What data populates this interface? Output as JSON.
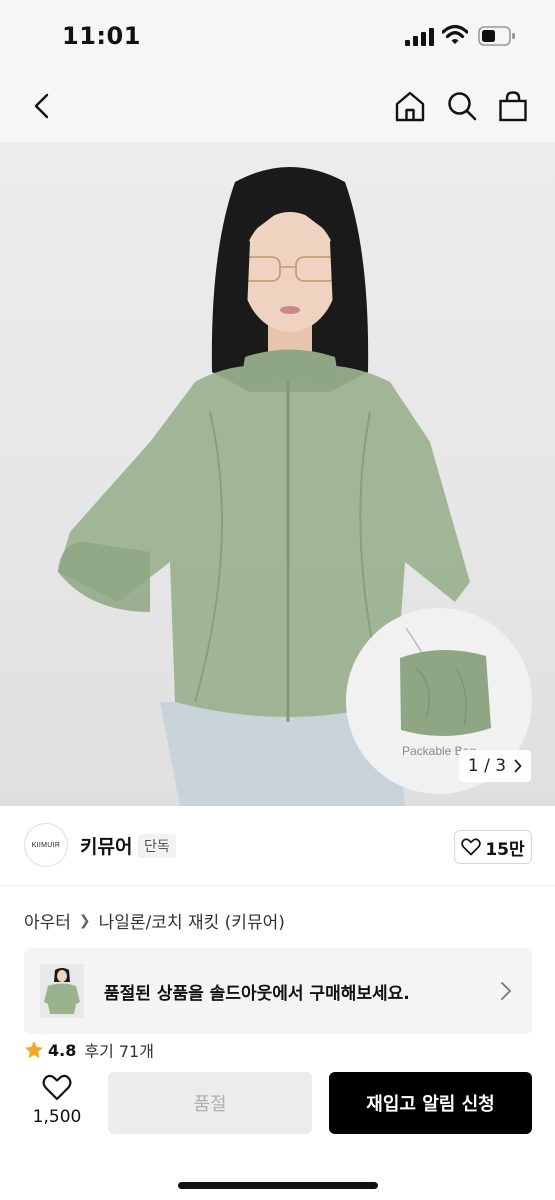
{
  "status_bar": {
    "time": "11:01"
  },
  "nav": {
    "icons": [
      "back-chevron-icon",
      "home-icon",
      "search-icon",
      "shopping-bag-icon"
    ]
  },
  "product_image": {
    "packable_label": "Packable Bag",
    "counter_current": "1",
    "counter_separator": "/",
    "counter_total": "3",
    "jacket_color": "#9bb28f"
  },
  "brand": {
    "logo_text": "KIIMUIR",
    "name": "키뮤어",
    "badge": "단독",
    "likes": "15만"
  },
  "breadcrumb": {
    "category": "아우터",
    "subcategory": "나일론/코치 재킷 (키뮤어)"
  },
  "soldout_banner": {
    "text": "품절된 상품을 솔드아웃에서 구매해보세요."
  },
  "rating": {
    "value": "4.8",
    "reviews": "후기 71개",
    "star_color": "#f5a623"
  },
  "bottom_bar": {
    "wish_count": "1,500",
    "soldout_label": "품절",
    "restock_label": "재입고 알림 신청"
  }
}
